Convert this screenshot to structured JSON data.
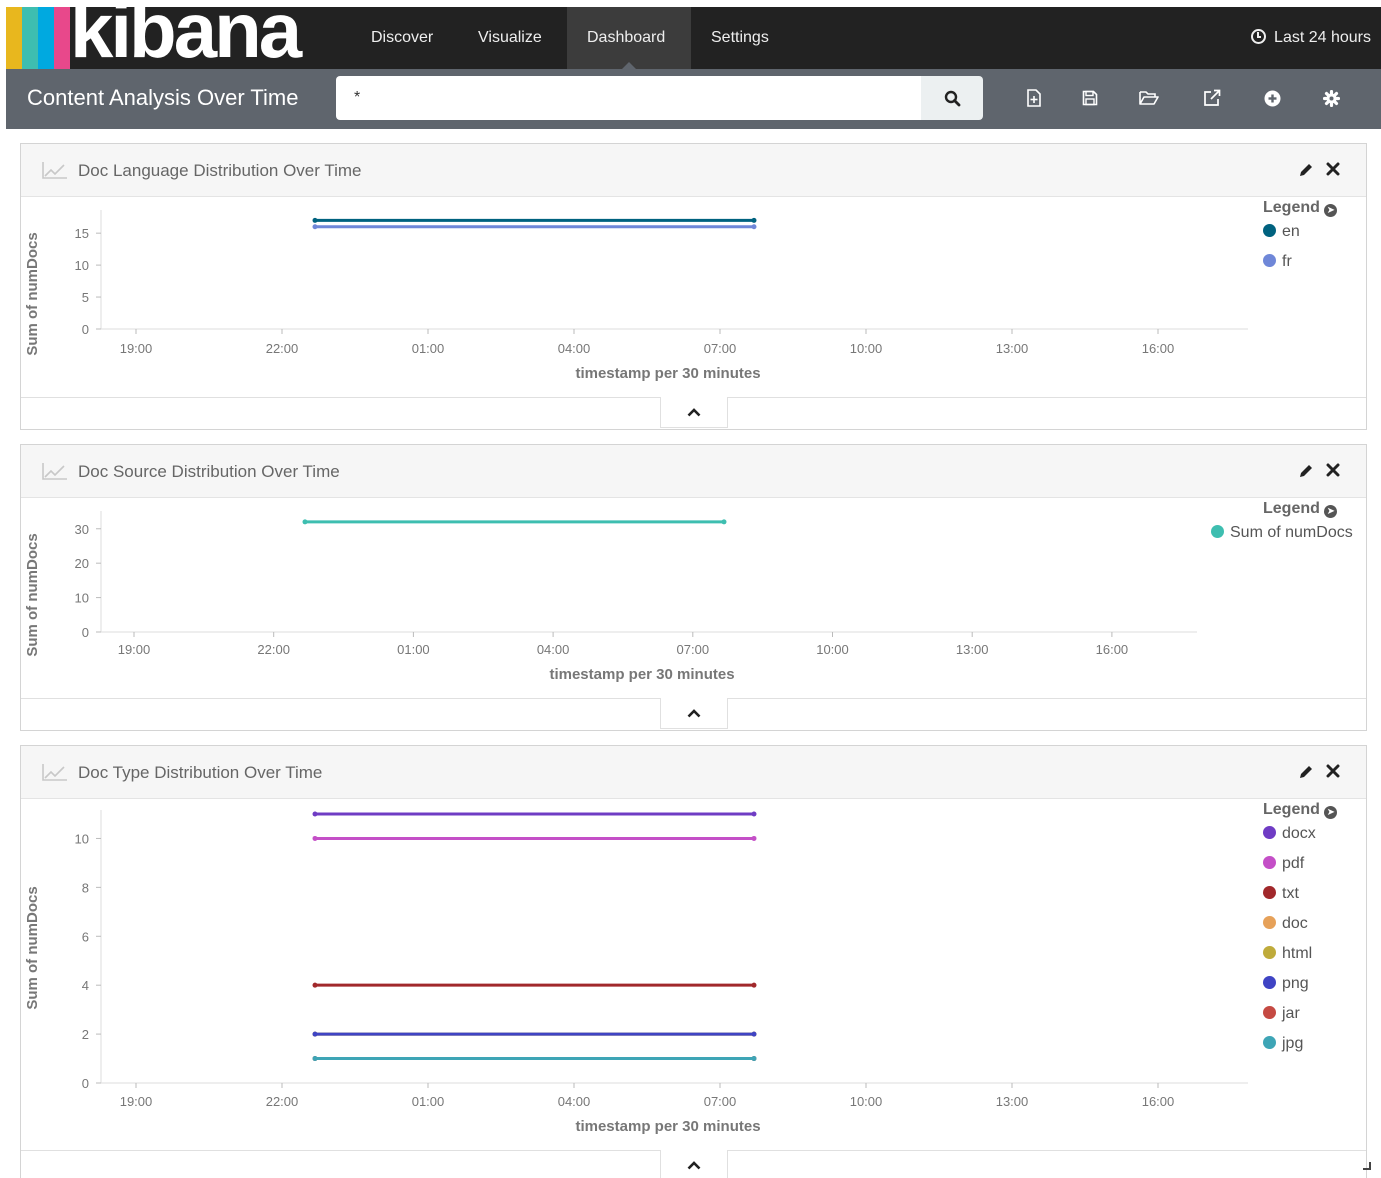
{
  "app": {
    "logo_text": "kibana",
    "logo_stripes": [
      "#e8b71e",
      "#3ebeb0",
      "#00a9e0",
      "#e8488b"
    ],
    "nav": [
      {
        "label": "Discover",
        "active": false
      },
      {
        "label": "Visualize",
        "active": false
      },
      {
        "label": "Dashboard",
        "active": true
      },
      {
        "label": "Settings",
        "active": false
      }
    ],
    "time_range": "Last 24 hours",
    "time_icon": "clock-icon"
  },
  "dashboard": {
    "title": "Content Analysis Over Time",
    "query": "*",
    "search_icon": "search-icon",
    "toolbar_icons": [
      "new-dashboard-icon",
      "save-icon",
      "open-folder-icon",
      "share-icon",
      "add-panel-icon",
      "settings-gear-icon"
    ]
  },
  "panels": [
    {
      "title": "Doc Language Distribution Over Time",
      "legend_title": "Legend",
      "legend": [
        {
          "label": "en",
          "color": "#00627f"
        },
        {
          "label": "fr",
          "color": "#6f87d8"
        }
      ]
    },
    {
      "title": "Doc Source Distribution Over Time",
      "legend_title": "Legend",
      "legend": [
        {
          "label": "Sum of numDocs",
          "color": "#3ebeb0"
        }
      ]
    },
    {
      "title": "Doc Type Distribution Over Time",
      "legend_title": "Legend",
      "legend": [
        {
          "label": "docx",
          "color": "#6f3cc4"
        },
        {
          "label": "pdf",
          "color": "#c44fc7"
        },
        {
          "label": "txt",
          "color": "#a1282b"
        },
        {
          "label": "doc",
          "color": "#e6a159"
        },
        {
          "label": "html",
          "color": "#bfab3b"
        },
        {
          "label": "png",
          "color": "#3f44c4"
        },
        {
          "label": "jar",
          "color": "#c54a43"
        },
        {
          "label": "jpg",
          "color": "#3ea5b6"
        }
      ]
    }
  ],
  "chart_data": [
    {
      "type": "line",
      "title": "Doc Language Distribution Over Time",
      "xlabel": "timestamp per 30 minutes",
      "ylabel": "Sum of numDocs",
      "x_ticks": [
        "19:00",
        "22:00",
        "01:00",
        "04:00",
        "07:00",
        "10:00",
        "13:00",
        "16:00"
      ],
      "y_ticks": [
        0,
        5,
        10,
        15
      ],
      "ylim": [
        0,
        18
      ],
      "x": [
        "23:30",
        "08:00"
      ],
      "series": [
        {
          "name": "en",
          "color": "#00627f",
          "values": [
            17,
            17
          ]
        },
        {
          "name": "fr",
          "color": "#6f87d8",
          "values": [
            16,
            16
          ]
        }
      ]
    },
    {
      "type": "line",
      "title": "Doc Source Distribution Over Time",
      "xlabel": "timestamp per 30 minutes",
      "ylabel": "Sum of numDocs",
      "x_ticks": [
        "19:00",
        "22:00",
        "01:00",
        "04:00",
        "07:00",
        "10:00",
        "13:00",
        "16:00"
      ],
      "y_ticks": [
        0,
        10,
        20,
        30
      ],
      "ylim": [
        0,
        34
      ],
      "x": [
        "23:30",
        "08:00"
      ],
      "series": [
        {
          "name": "Sum of numDocs",
          "color": "#3ebeb0",
          "values": [
            32,
            32
          ]
        }
      ]
    },
    {
      "type": "line",
      "title": "Doc Type Distribution Over Time",
      "xlabel": "timestamp per 30 minutes",
      "ylabel": "Sum of numDocs",
      "x_ticks": [
        "19:00",
        "22:00",
        "01:00",
        "04:00",
        "07:00",
        "10:00",
        "13:00",
        "16:00"
      ],
      "y_ticks": [
        0,
        2,
        4,
        6,
        8,
        10
      ],
      "ylim": [
        0,
        11
      ],
      "x": [
        "23:30",
        "08:00"
      ],
      "series": [
        {
          "name": "docx",
          "color": "#6f3cc4",
          "values": [
            11,
            11
          ]
        },
        {
          "name": "pdf",
          "color": "#c44fc7",
          "values": [
            10,
            10
          ]
        },
        {
          "name": "txt",
          "color": "#a1282b",
          "values": [
            4,
            4
          ]
        },
        {
          "name": "doc",
          "color": "#e6a159",
          "values": [
            2,
            2
          ]
        },
        {
          "name": "html",
          "color": "#bfab3b",
          "values": [
            2,
            2
          ]
        },
        {
          "name": "png",
          "color": "#3f44c4",
          "values": [
            2,
            2
          ]
        },
        {
          "name": "jar",
          "color": "#c54a43",
          "values": [
            1,
            1
          ]
        },
        {
          "name": "jpg",
          "color": "#3ea5b6",
          "values": [
            1,
            1
          ]
        }
      ]
    }
  ]
}
